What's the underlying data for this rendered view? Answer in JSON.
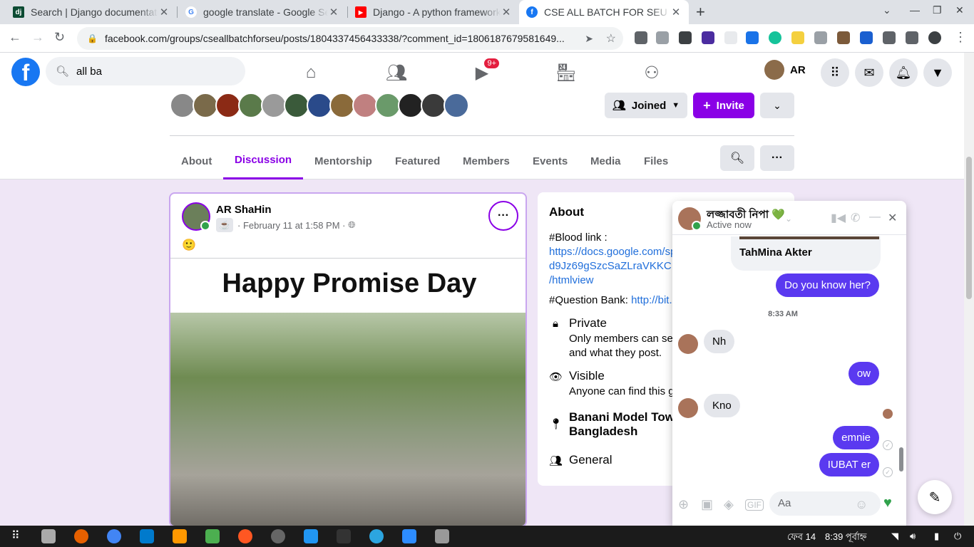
{
  "browser": {
    "tabs": [
      {
        "title": "Search | Django documentation",
        "favicon": "dj"
      },
      {
        "title": "google translate - Google Search",
        "favicon": "G"
      },
      {
        "title": "Django - A python framework",
        "favicon": "▶"
      },
      {
        "title": "CSE ALL BATCH FOR SEU | Facebook",
        "favicon": "f"
      }
    ],
    "url": "facebook.com/groups/cseallbatchforseu/posts/1804337456433338/?comment_id=1806187679581649..."
  },
  "fb": {
    "search_value": "all ba",
    "watch_badge": "9+",
    "profile_name": "AR"
  },
  "group": {
    "joined_label": "Joined",
    "invite_label": "Invite",
    "tabs": [
      "About",
      "Discussion",
      "Mentorship",
      "Featured",
      "Members",
      "Events",
      "Media",
      "Files"
    ]
  },
  "post": {
    "author": "AR ShaHin",
    "date": "February 11 at 1:58 PM",
    "text": "🙂",
    "image_caption": "Happy Promise Day"
  },
  "about": {
    "title": "About",
    "blood_label": "#Blood link :",
    "blood_link_1": "https://docs.google.com/sp",
    "blood_link_2": "d9Jz69gSzcSaZLraVKKC",
    "blood_link_3": "/htmlview",
    "qbank_label": "#Question Bank:",
    "qbank_link": "http://bit.",
    "private_title": "Private",
    "private_desc_1": "Only members can se",
    "private_desc_2": "and what they post.",
    "visible_title": "Visible",
    "visible_desc": "Anyone can find this g",
    "location_1": "Banani Model Tow",
    "location_2": "Bangladesh",
    "general": "General"
  },
  "chat": {
    "name": "লজ্জাবতী নিপা 💚",
    "status": "Active now",
    "shared_name": "TahMina Akter",
    "msg1": "Do you know her?",
    "time": "8:33 AM",
    "msg2": "Nh",
    "msg3": "ow",
    "msg4": "Kno",
    "msg5": "emnie",
    "msg6": "IUBAT er",
    "input_placeholder": "Aa"
  },
  "taskbar": {
    "date": "ফেব 14",
    "time": "8:39 পূর্বাহ্ন"
  }
}
